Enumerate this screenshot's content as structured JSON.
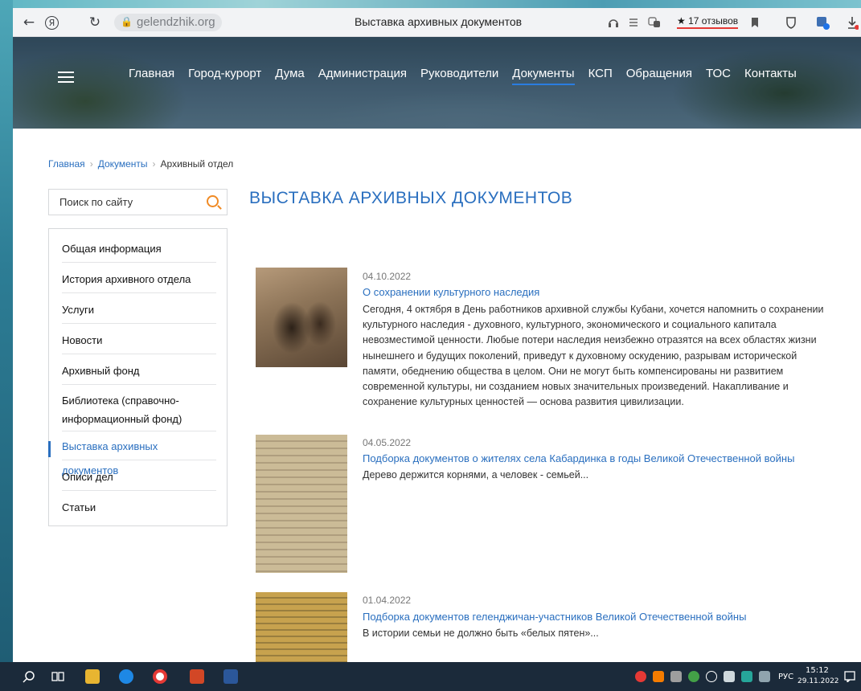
{
  "browser": {
    "url": "gelendzhik.org",
    "tab_title": "Выставка архивных документов",
    "reviews": "17 отзывов",
    "back_glyph": "←",
    "reload_glyph": "↻",
    "yandex_glyph": "Я"
  },
  "nav": {
    "items": [
      "Главная",
      "Город-курорт",
      "Дума",
      "Администрация",
      "Руководители",
      "Документы",
      "КСП",
      "Обращения",
      "ТОС",
      "Контакты"
    ],
    "active_index": 5
  },
  "breadcrumb": {
    "home": "Главная",
    "docs": "Документы",
    "current": "Архивный отдел",
    "separator": "›"
  },
  "search": {
    "placeholder": "Поиск по сайту"
  },
  "sidebar": {
    "items": [
      "Общая информация",
      "История архивного отдела",
      "Услуги",
      "Новости",
      "Архивный фонд",
      "Библиотека (справочно-информационный фонд)",
      "Выставка архивных документов",
      "Описи дел",
      "Статьи"
    ],
    "active_index": 6
  },
  "page": {
    "title": "ВЫСТАВКА АРХИВНЫХ ДОКУМЕНТОВ"
  },
  "news": [
    {
      "date": "04.10.2022",
      "title": "О сохранении культурного наследия",
      "text": "Сегодня, 4 октября в День  работников архивной службы Кубани, хочется напомнить о сохранении культурного наследия - духовного, культурного, экономического и социального капитала невозместимой ценности. Любые потери наследия неизбежно отразятся на всех областях жизни нынешнего и будущих поколений, приведут к духовному оскудению, разрывам исторической памяти, обеднению общества в целом. Они не могут быть компенсированы ни развитием современной культуры, ни созданием новых значительных произведений. Накапливание и сохранение культурных ценностей — основа развития цивилизации."
    },
    {
      "date": "04.05.2022",
      "title": "Подборка документов о жителях села Кабардинка в годы Великой Отечественной войны",
      "text": "Дерево держится корнями, а человек - семьей..."
    },
    {
      "date": "01.04.2022",
      "title": "Подборка документов геленджичан-участников Великой Отечественной войны",
      "text": "В истории семьи не должно быть «белых пятен»..."
    }
  ],
  "taskbar": {
    "lang": "РУС",
    "time": "15:12",
    "date": "29.11.2022"
  },
  "colors": {
    "accent": "#2a6fbf",
    "search_icon": "#f08a24",
    "taskbar": "#1b2a3a"
  }
}
